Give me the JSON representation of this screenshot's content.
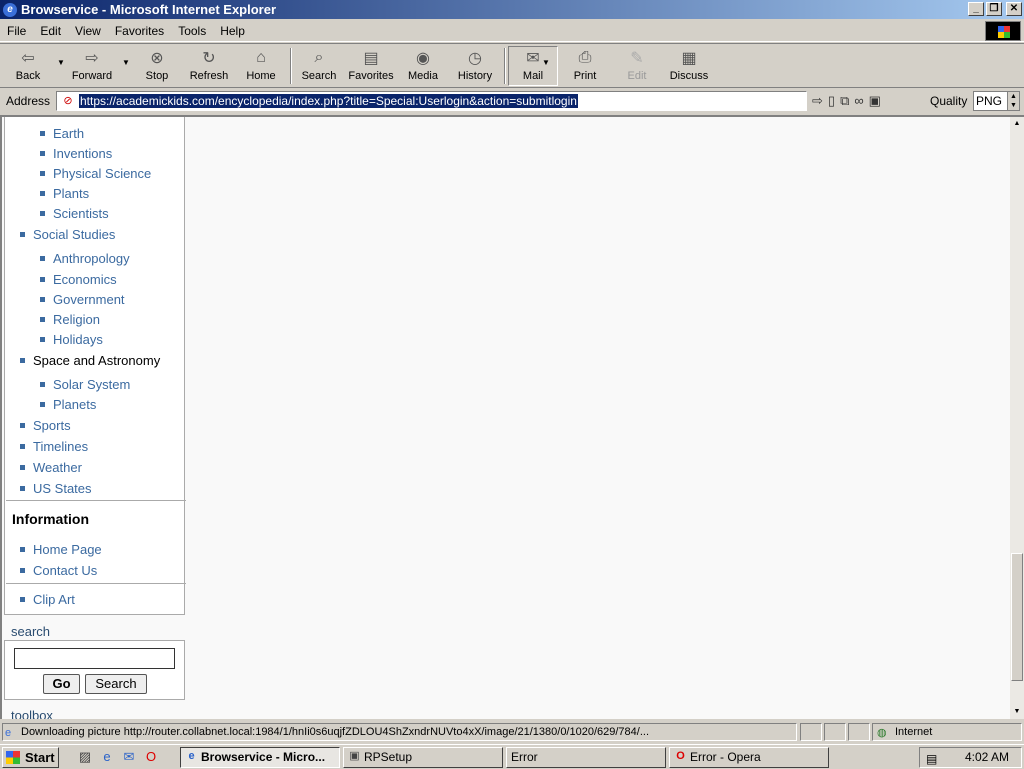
{
  "window": {
    "title": "Browservice - Microsoft Internet Explorer"
  },
  "menu": [
    "File",
    "Edit",
    "View",
    "Favorites",
    "Tools",
    "Help"
  ],
  "toolbar": {
    "back": "Back",
    "forward": "Forward",
    "stop": "Stop",
    "refresh": "Refresh",
    "home": "Home",
    "search": "Search",
    "favorites": "Favorites",
    "media": "Media",
    "history": "History",
    "mail": "Mail",
    "print": "Print",
    "edit": "Edit",
    "discuss": "Discuss"
  },
  "address": {
    "label": "Address",
    "url": "https://academickids.com/encyclopedia/index.php?title=Special:Userlogin&action=submitlogin",
    "quality_label": "Quality",
    "quality_value": "PNG"
  },
  "sidebar": {
    "science_items": [
      "Earth",
      "Inventions",
      "Physical Science",
      "Plants",
      "Scientists"
    ],
    "social_studies": "Social Studies",
    "social_items": [
      "Anthropology",
      "Economics",
      "Government",
      "Religion",
      "Holidays"
    ],
    "space": "Space and Astronomy",
    "space_items": [
      "Solar System",
      "Planets"
    ],
    "more": [
      "Sports",
      "Timelines",
      "Weather",
      "US States"
    ],
    "information_title": "Information",
    "info_items": [
      "Home Page",
      "Contact Us"
    ],
    "clip_art": "Clip Art",
    "search_label": "search",
    "go_button": "Go",
    "search_button": "Search",
    "toolbox_label": "toolbox"
  },
  "status": {
    "message": "Downloading picture http://router.collabnet.local:1984/1/hnIi0s6uqjfZDLOU4ShZxndrNUVto4xX/image/21/1380/0/1020/629/784/...",
    "zone": "Internet"
  },
  "taskbar": {
    "start": "Start",
    "tasks": [
      "Browservice - Micro...",
      "RPSetup",
      "Error",
      "Error - Opera"
    ],
    "clock": "4:02 AM"
  }
}
